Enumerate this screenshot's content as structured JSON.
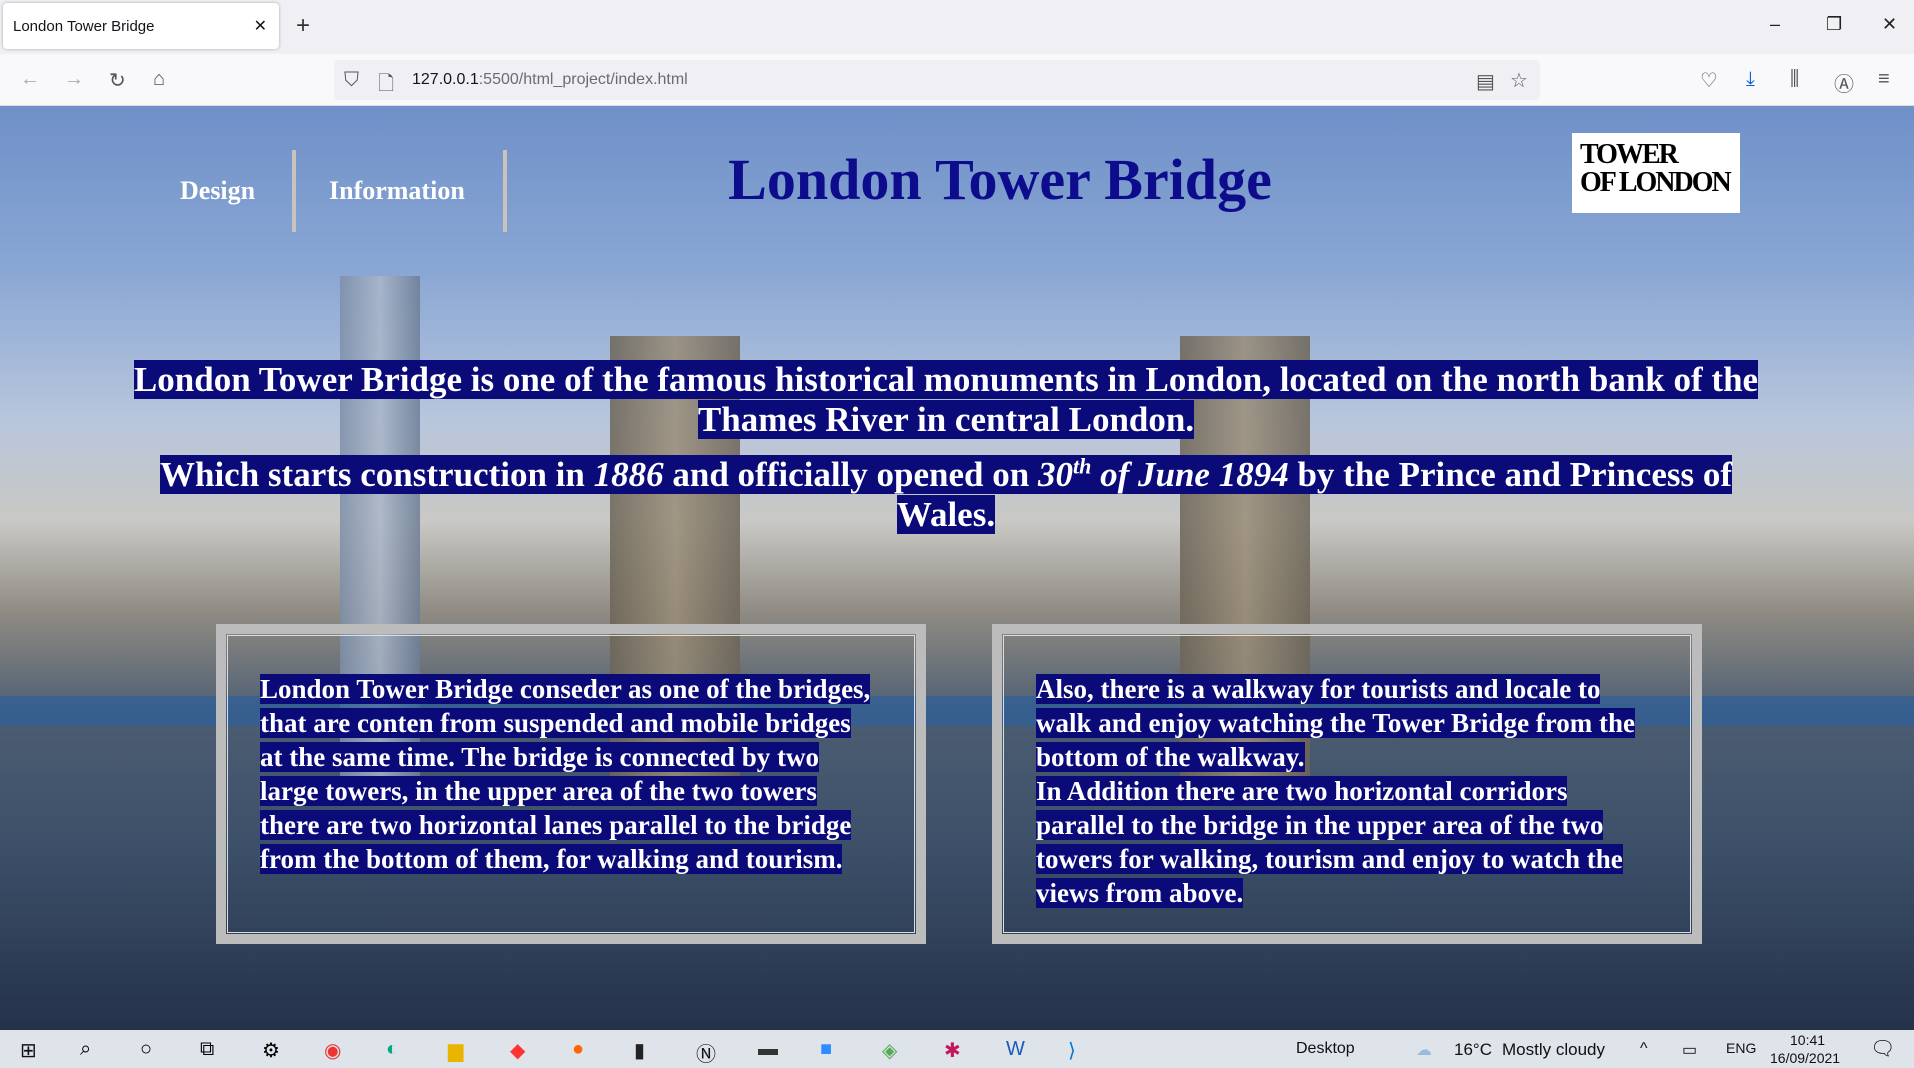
{
  "browser": {
    "tab_title": "London Tower Bridge",
    "url_host": "127.0.0.1",
    "url_rest": ":5500/html_project/index.html"
  },
  "page": {
    "nav": [
      {
        "label": "Design"
      },
      {
        "label": "Information"
      }
    ],
    "title": "London Tower Bridge",
    "logo_text": "TOWER OF LONDON",
    "intro_1": "London Tower Bridge is one of the famous historical monuments in London, located on the north bank of the Thames River in central London.",
    "intro_2a": "Which starts construction in ",
    "intro_2b": "1886",
    "intro_2c": " and officially opened on ",
    "intro_2d": "30",
    "intro_2e": "th",
    "intro_2f": " of June 1894",
    "intro_2g": " by the Prince and Princess of Wales.",
    "box_left": "London Tower Bridge conseder as one of the bridges, that are conten from suspended and mobile bridges at the same time. The bridge is connected by two large towers, in the upper area of the two towers there are two horizontal lanes parallel to the bridge from the bottom of them, for walking and tourism.",
    "box_right_1": "Also, there is a walkway for tourists and locale to walk and enjoy watching the Tower Bridge from the bottom of the walkway.",
    "box_right_2": "In Addition there are two horizontal corridors parallel to the bridge in the upper area of the two towers for walking, tourism and enjoy to watch the views from above."
  },
  "taskbar": {
    "desktop_label": "Desktop",
    "temperature": "16°C",
    "weather": "Mostly cloudy",
    "language": "ENG",
    "time": "10:41",
    "date": "16/09/2021"
  },
  "colors": {
    "title": "#0c0c8c",
    "highlight": "#0a0a78",
    "border": "#bdbcbc"
  }
}
